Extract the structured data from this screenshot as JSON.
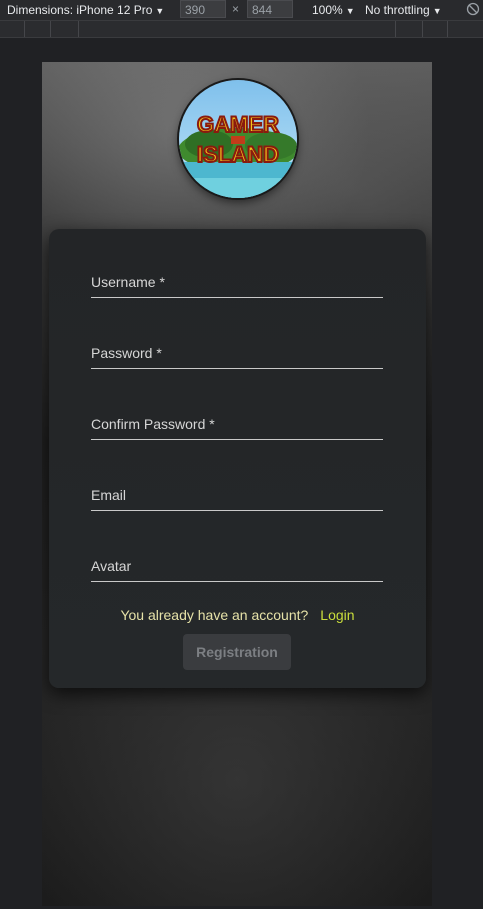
{
  "devtools": {
    "dimensions_label": "Dimensions: iPhone 12 Pro",
    "width": "390",
    "times": "×",
    "height": "844",
    "zoom": "100%",
    "throttle": "No throttling",
    "caret": "▼"
  },
  "logo": {
    "line1": "GAMER",
    "line2": "ISLAND"
  },
  "form": {
    "username_label": "Username *",
    "password_label": "Password *",
    "confirm_label": "Confirm Password *",
    "email_label": "Email",
    "avatar_label": "Avatar"
  },
  "login": {
    "question": "You already have an account?",
    "link": "Login"
  },
  "register_button": "Registration",
  "colors": {
    "link": "#c9dd3c",
    "question": "#e6e2a8",
    "card": "#24272a"
  }
}
